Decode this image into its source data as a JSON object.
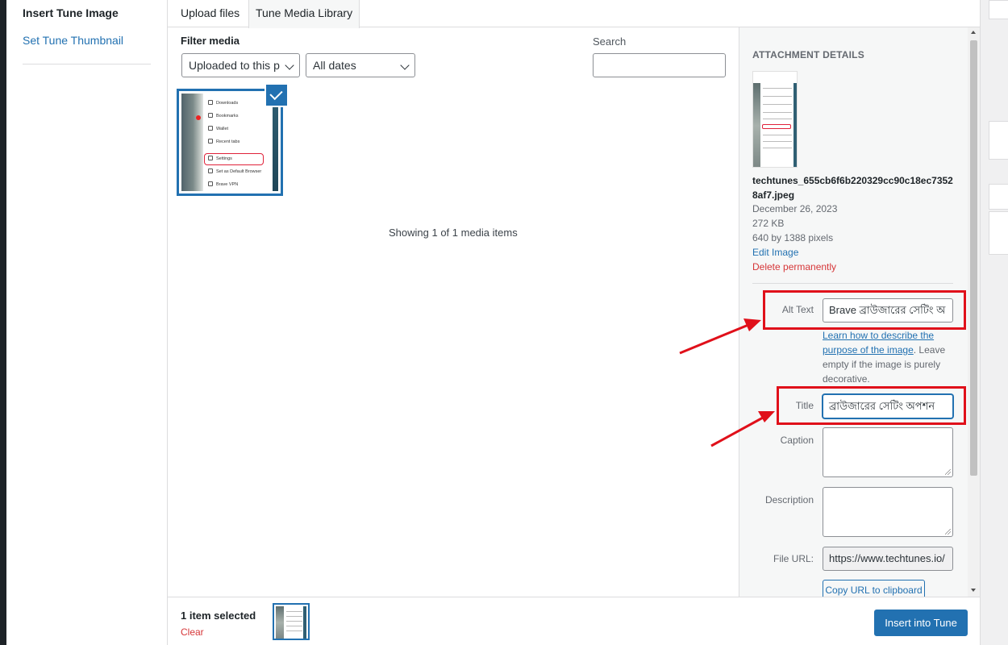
{
  "menu": {
    "title": "Insert Tune Image",
    "link": "Set Tune Thumbnail"
  },
  "tabs": [
    {
      "label": "Upload files",
      "active": false
    },
    {
      "label": "Tune Media Library",
      "active": true
    }
  ],
  "filter": {
    "label": "Filter media",
    "type_value": "Uploaded to this p",
    "date_value": "All dates",
    "search_label": "Search",
    "search_value": ""
  },
  "library": {
    "thumb_items": [
      "Downloads",
      "Bookmarks",
      "Wallet",
      "Recent tabs",
      "Settings",
      "Set as Default Browser",
      "Brave VPN"
    ],
    "showing": "Showing 1 of 1 media items"
  },
  "details": {
    "heading": "Attachment Details",
    "filename": "techtunes_655cb6f6b220329cc90c18ec73528af7.jpeg",
    "date": "December 26, 2023",
    "size": "272 KB",
    "dimensions": "640 by 1388 pixels",
    "edit_label": "Edit Image",
    "delete_label": "Delete permanently",
    "alt_label": "Alt Text",
    "alt_value": "Brave ব্রাউজারের সেটিং অ",
    "help_link": "Learn how to describe the purpose of the image",
    "help_text": ". Leave empty if the image is purely decorative.",
    "title_label": "Title",
    "title_value": "ব্রাউজারের সেটিং অপশন",
    "caption_label": "Caption",
    "description_label": "Description",
    "url_label": "File URL:",
    "url_value": "https://www.techtunes.io/",
    "copy_label": "Copy URL to clipboard"
  },
  "toolbar": {
    "selected": "1 item selected",
    "clear": "Clear",
    "insert": "Insert into Tune"
  },
  "colors": {
    "accent": "#2271b1",
    "danger": "#d63638",
    "annotation": "#e0101a"
  }
}
